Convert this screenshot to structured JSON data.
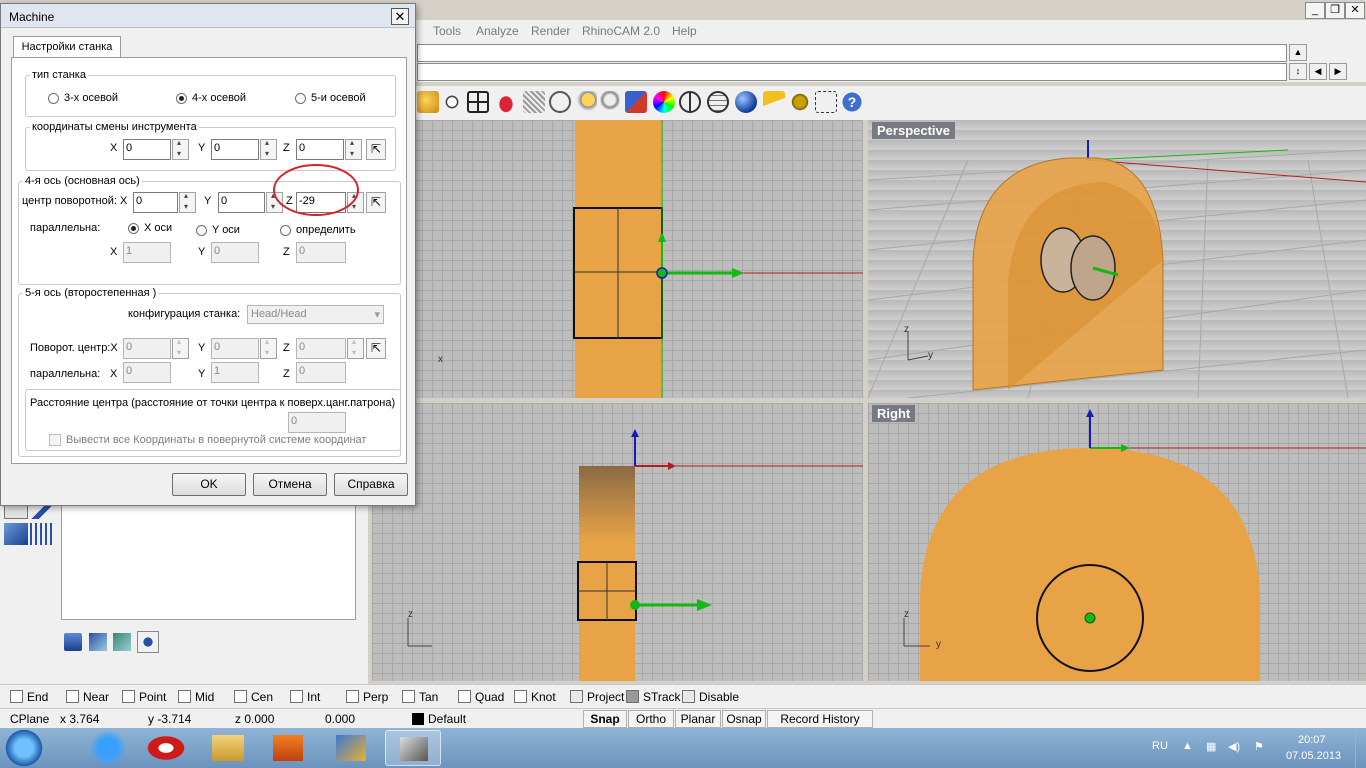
{
  "window": {
    "menu": [
      "Tools",
      "Analyze",
      "Render",
      "RhinoCAM 2.0",
      "Help"
    ],
    "controls": [
      "_",
      "❐",
      "✕"
    ]
  },
  "viewports": {
    "top_left": {
      "axis_x": "x"
    },
    "perspective": {
      "title": "Perspective",
      "axis_z": "z",
      "axis_y": "y"
    },
    "bottom_left": {
      "axis_z": "z"
    },
    "right": {
      "title": "Right",
      "axis_z": "z",
      "axis_y": "y"
    }
  },
  "dialog": {
    "title": "Machine",
    "close": "✕",
    "tab": "Настройки станка",
    "machine_type": {
      "legend": "тип станка",
      "options": [
        "3-х осевой",
        "4-х осевой",
        "5-и осевой"
      ],
      "selected": "4-х осевой"
    },
    "tool_change": {
      "legend": "координаты смены инструмента",
      "x_label": "X",
      "x": "0",
      "y_label": "Y",
      "y": "0",
      "z_label": "Z",
      "z": "0"
    },
    "axis4": {
      "legend": "4-я ось (основная ось)",
      "center_label": "центр поворотной: X",
      "x": "0",
      "y_label": "Y",
      "y": "0",
      "z_label": "Z",
      "z": "-29",
      "parallel_label": "параллельна:",
      "options": [
        "X оси",
        "Y оси",
        "определить"
      ],
      "selected": "X оси",
      "vx_label": "X",
      "vx": "1",
      "vy_label": "Y",
      "vy": "0",
      "vz_label": "Z",
      "vz": "0"
    },
    "axis5": {
      "legend": "5-я ось (второстепенная )",
      "config_label": "конфигурация станка:",
      "config_value": "Head/Head",
      "center_label": "Поворот. центр:X",
      "x": "0",
      "y_label": "Y",
      "y": "0",
      "z_label": "Z",
      "z": "0",
      "parallel_label": "параллельна:",
      "vx_label": "X",
      "vx": "0",
      "vy_label": "Y",
      "vy": "1",
      "vz_label": "Z",
      "vz": "0"
    },
    "center_distance": {
      "legend": "Расстояние центра (расстояние от точки центра к поверх.цанг.патрона)",
      "value": "0",
      "checkbox_label": "Вывести все Координаты в повернутой системе координат"
    },
    "buttons": {
      "ok": "OK",
      "cancel": "Отмена",
      "help": "Справка"
    }
  },
  "osnap": {
    "items": [
      {
        "label": "End",
        "checked": false
      },
      {
        "label": "Near",
        "checked": false
      },
      {
        "label": "Point",
        "checked": false
      },
      {
        "label": "Mid",
        "checked": false
      },
      {
        "label": "Cen",
        "checked": false
      },
      {
        "label": "Int",
        "checked": false
      },
      {
        "label": "Perp",
        "checked": false
      },
      {
        "label": "Tan",
        "checked": false
      },
      {
        "label": "Quad",
        "checked": false
      },
      {
        "label": "Knot",
        "checked": false
      },
      {
        "label": "Project",
        "checked": false
      },
      {
        "label": "STrack",
        "checked": false
      },
      {
        "label": "Disable",
        "checked": false
      }
    ]
  },
  "status": {
    "cplane": "CPlane",
    "x": "x 3.764",
    "y": "y -3.714",
    "z": "z 0.000",
    "dist": "0.000",
    "layer": "Default",
    "snap": "Snap",
    "ortho": "Ortho",
    "planar": "Planar",
    "osnap": "Osnap",
    "record_history": "Record History"
  },
  "taskbar": {
    "lang": "RU",
    "time": "20:07",
    "date": "07.05.2013"
  },
  "colors": {
    "object": "#e8a347",
    "viewport_bg": "#bdbdbd",
    "annotation_red": "#d8202a",
    "axis_green": "#14b814",
    "axis_blue": "#1a1ab8",
    "axis_red": "#b02020"
  }
}
